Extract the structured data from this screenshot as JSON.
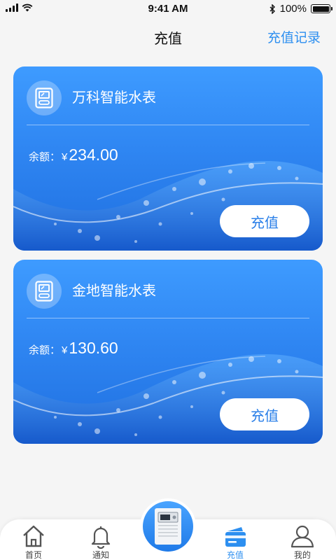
{
  "status_bar": {
    "time": "9:41 AM",
    "battery": "100%",
    "battery_level": 1.0
  },
  "nav": {
    "title": "充值",
    "action": "充值记录"
  },
  "cards": [
    {
      "name": "万科智能水表",
      "balance_label": "余额：",
      "currency": "¥",
      "amount": "234.00",
      "button": "充值"
    },
    {
      "name": "金地智能水表",
      "balance_label": "余额：",
      "currency": "¥",
      "amount": "130.60",
      "button": "充值"
    }
  ],
  "tabs": [
    {
      "label": "首页",
      "icon": "home-icon",
      "active": false
    },
    {
      "label": "通知",
      "icon": "bell-icon",
      "active": false
    },
    {
      "label": "充值",
      "icon": "card-icon",
      "active": true
    },
    {
      "label": "我的",
      "icon": "user-icon",
      "active": false
    }
  ],
  "center_button": {
    "icon": "water-meter-icon"
  },
  "colors": {
    "accent": "#2d8ff0",
    "card_top": "#3e9bff",
    "card_bottom": "#1f6fe0",
    "background": "#f5f5f5"
  }
}
